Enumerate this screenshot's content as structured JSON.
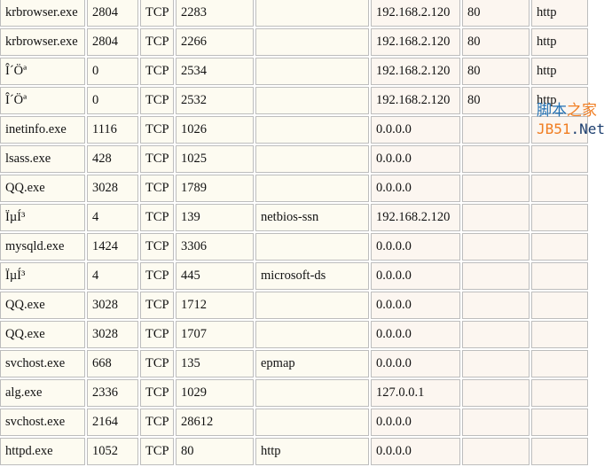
{
  "rows": [
    [
      "krbrowser.exe",
      "2804",
      "TCP",
      "2283",
      "",
      "192.168.2.120",
      "80",
      "http"
    ],
    [
      "krbrowser.exe",
      "2804",
      "TCP",
      "2266",
      "",
      "192.168.2.120",
      "80",
      "http"
    ],
    [
      "Î´Öª",
      "0",
      "TCP",
      "2534",
      "",
      "192.168.2.120",
      "80",
      "http"
    ],
    [
      "Î´Öª",
      "0",
      "TCP",
      "2532",
      "",
      "192.168.2.120",
      "80",
      "http"
    ],
    [
      "inetinfo.exe",
      "1116",
      "TCP",
      "1026",
      "",
      "0.0.0.0",
      "",
      ""
    ],
    [
      "lsass.exe",
      "428",
      "TCP",
      "1025",
      "",
      "0.0.0.0",
      "",
      ""
    ],
    [
      "QQ.exe",
      "3028",
      "TCP",
      "1789",
      "",
      "0.0.0.0",
      "",
      ""
    ],
    [
      "ÏµÍ³",
      "4",
      "TCP",
      "139",
      "netbios-ssn",
      "192.168.2.120",
      "",
      ""
    ],
    [
      "mysqld.exe",
      "1424",
      "TCP",
      "3306",
      "",
      "0.0.0.0",
      "",
      ""
    ],
    [
      "ÏµÍ³",
      "4",
      "TCP",
      "445",
      "microsoft-ds",
      "0.0.0.0",
      "",
      ""
    ],
    [
      "QQ.exe",
      "3028",
      "TCP",
      "1712",
      "",
      "0.0.0.0",
      "",
      ""
    ],
    [
      "QQ.exe",
      "3028",
      "TCP",
      "1707",
      "",
      "0.0.0.0",
      "",
      ""
    ],
    [
      "svchost.exe",
      "668",
      "TCP",
      "135",
      "epmap",
      "0.0.0.0",
      "",
      ""
    ],
    [
      "alg.exe",
      "2336",
      "TCP",
      "1029",
      "",
      "127.0.0.1",
      "",
      ""
    ],
    [
      "svchost.exe",
      "2164",
      "TCP",
      "28612",
      "",
      "0.0.0.0",
      "",
      ""
    ],
    [
      "httpd.exe",
      "1052",
      "TCP",
      "80",
      "http",
      "0.0.0.0",
      "",
      ""
    ]
  ],
  "watermark": {
    "line1a": "脚本",
    "line1b": "之家",
    "line2a": "JB51",
    "line2b": ".Net"
  }
}
